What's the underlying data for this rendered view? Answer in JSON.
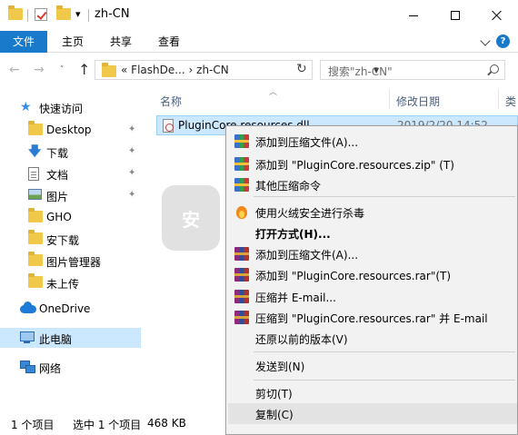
{
  "window": {
    "title": "zh-CN",
    "qat_dropdown": "▾"
  },
  "ribbon": {
    "tabs": [
      "文件",
      "主页",
      "共享",
      "查看"
    ],
    "help": "?"
  },
  "nav": {
    "back": "←",
    "forward": "→",
    "history": "˅",
    "up": "↑",
    "path_prefix": "«",
    "path": [
      "FlashDe...",
      "zh-CN"
    ],
    "path_sep": "›",
    "refresh": "↻",
    "search_placeholder": "搜索\"zh-CN\""
  },
  "sidebar": {
    "quick_access": "快速访问",
    "items": [
      {
        "label": "Desktop",
        "icon": "folder-icon",
        "pinned": true
      },
      {
        "label": "下载",
        "icon": "download-icon",
        "pinned": true
      },
      {
        "label": "文档",
        "icon": "document-icon",
        "pinned": true
      },
      {
        "label": "图片",
        "icon": "picture-icon",
        "pinned": true
      },
      {
        "label": "GHO",
        "icon": "folder-icon",
        "pinned": false
      },
      {
        "label": "安下载",
        "icon": "folder-icon",
        "pinned": false
      },
      {
        "label": "图片管理器",
        "icon": "folder-icon",
        "pinned": false
      },
      {
        "label": "未上传",
        "icon": "folder-icon",
        "pinned": false
      }
    ],
    "onedrive": "OneDrive",
    "this_pc": "此电脑",
    "network": "网络",
    "pin_glyph": "✦"
  },
  "columns": {
    "name": "名称",
    "modified": "修改日期",
    "type": "类"
  },
  "files": [
    {
      "name": "PluginCore.resources.dll",
      "date": "2019/2/20 14:52"
    }
  ],
  "watermark": {
    "glyph": "安"
  },
  "status": {
    "count": "1 个项目",
    "selected": "选中 1 个项目",
    "size": "468 KB"
  },
  "context_menu": {
    "items": [
      {
        "label": "添加到压缩文件(A)...",
        "icon": "archive-icon"
      },
      {
        "label": "添加到 \"PluginCore.resources.zip\" (T)",
        "icon": "archive-icon"
      },
      {
        "label": "其他压缩命令",
        "icon": "archive-icon"
      },
      {
        "label": "使用火绒安全进行杀毒",
        "icon": "huorong-icon"
      },
      {
        "label": "打开方式(H)...",
        "bold": true
      },
      {
        "label": "添加到压缩文件(A)...",
        "icon": "winrar-icon"
      },
      {
        "label": "添加到 \"PluginCore.resources.rar\"(T)",
        "icon": "winrar-icon"
      },
      {
        "label": "压缩并 E-mail...",
        "icon": "winrar-icon"
      },
      {
        "label": "压缩到 \"PluginCore.resources.rar\" 并 E-mail",
        "icon": "winrar-icon"
      },
      {
        "label": "还原以前的版本(V)"
      },
      {
        "label": "发送到(N)"
      },
      {
        "label": "剪切(T)"
      },
      {
        "label": "复制(C)",
        "highlighted": true
      }
    ]
  }
}
